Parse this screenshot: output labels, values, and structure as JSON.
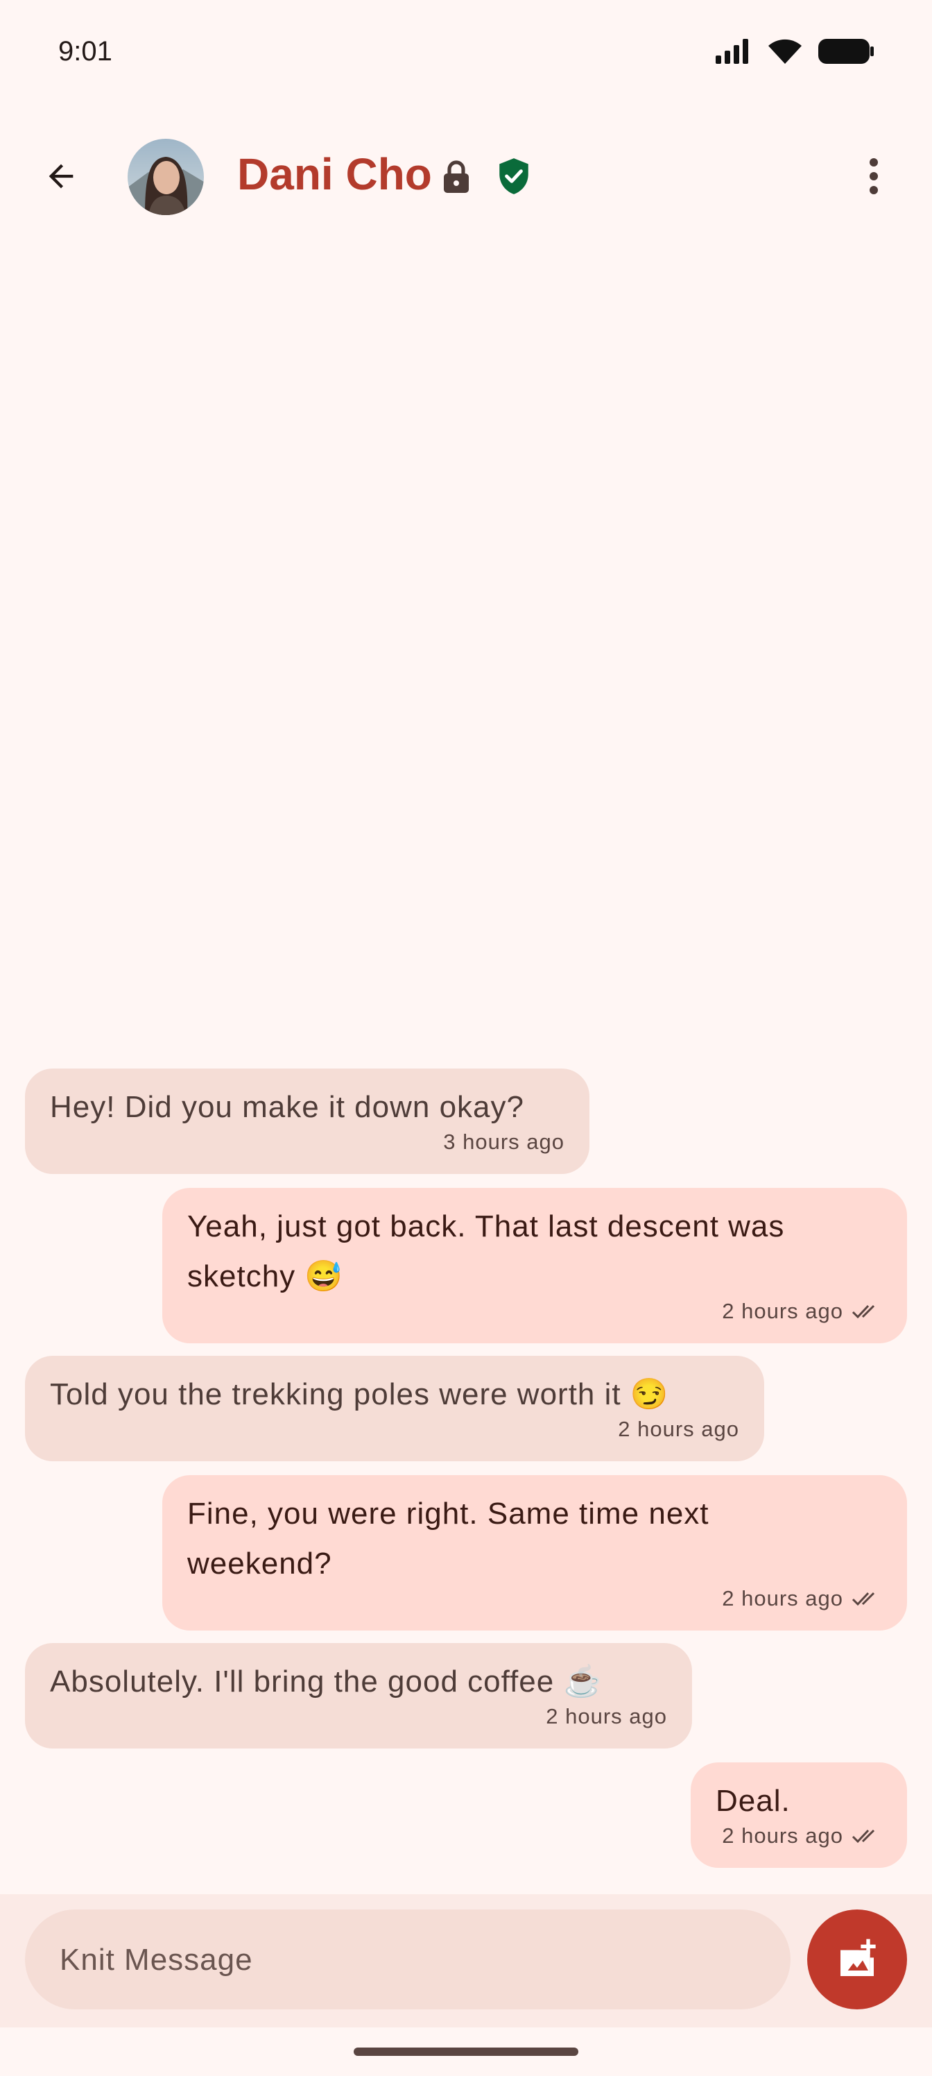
{
  "status_bar": {
    "time": "9:01"
  },
  "header": {
    "contact_name": "Dani Cho",
    "icons": [
      "back-arrow-icon",
      "lock-icon",
      "verified-shield-icon",
      "more-vert-icon"
    ],
    "accent_color": "#b33b2c",
    "verified_color": "#0a6b3a"
  },
  "messages": [
    {
      "direction": "incoming",
      "text": "Hey! Did you make it down okay?",
      "time": "3 hours ago"
    },
    {
      "direction": "outgoing",
      "text": "Yeah, just got back. That last descent was sketchy 😅",
      "time": "2 hours ago",
      "read": true
    },
    {
      "direction": "incoming",
      "text": "Told you the trekking poles were worth it 😏",
      "time": "2 hours ago"
    },
    {
      "direction": "outgoing",
      "text": "Fine, you were right. Same time next weekend?",
      "time": "2 hours ago",
      "read": true
    },
    {
      "direction": "incoming",
      "text": "Absolutely. I'll bring the good coffee ☕",
      "time": "2 hours ago"
    },
    {
      "direction": "outgoing",
      "text": "Deal.",
      "time": "2 hours ago",
      "read": true
    }
  ],
  "composer": {
    "placeholder": "Knit Message",
    "value": "",
    "attach_icon": "add-photo-icon",
    "button_color": "#c0392b"
  }
}
